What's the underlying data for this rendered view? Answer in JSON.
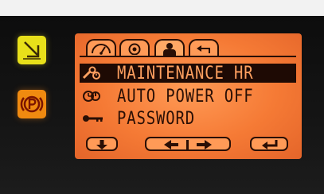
{
  "side_buttons": [
    {
      "icon": "diagonal-arrow-icon",
      "color": "#e8e01a"
    },
    {
      "icon": "parking-brake-icon",
      "color": "#f08a10"
    }
  ],
  "display": {
    "background_color": "#f57a35",
    "ink_color": "#2a0f05",
    "tabs": [
      {
        "icon": "fuel-gauge-icon",
        "active": false
      },
      {
        "icon": "tire-icon",
        "active": false
      },
      {
        "icon": "operator-icon",
        "active": true
      },
      {
        "icon": "return-arrow-icon",
        "active": false
      }
    ],
    "menu": [
      {
        "icon": "maintenance-wrench-icon",
        "label": "MAINTENANCE HR",
        "selected": true
      },
      {
        "icon": "auto-power-icon",
        "label": "AUTO POWER OFF",
        "selected": false
      },
      {
        "icon": "key-icon",
        "label": "PASSWORD",
        "selected": false
      }
    ],
    "softkeys": [
      {
        "icon": "arrow-down-icon"
      },
      {
        "icon": "arrow-left-right-icon"
      },
      {
        "icon": "enter-icon"
      }
    ]
  }
}
